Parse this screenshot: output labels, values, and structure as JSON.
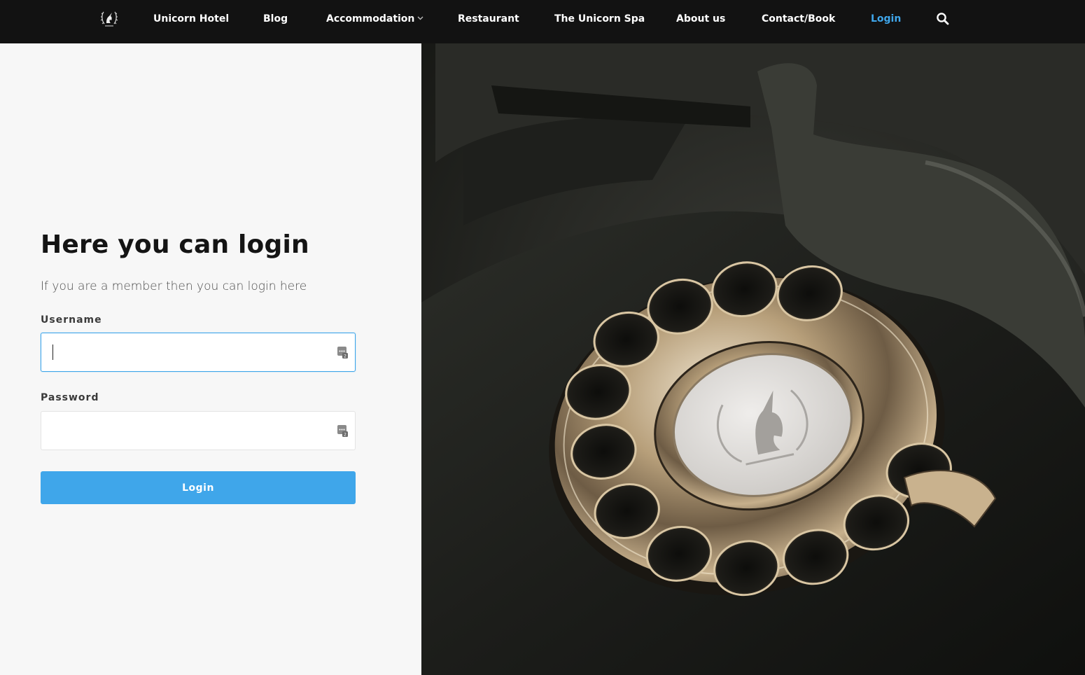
{
  "nav": {
    "logo_icon": "unicorn-laurel-logo",
    "items": [
      {
        "label": "Unicorn Hotel"
      },
      {
        "label": "Blog"
      },
      {
        "label": "Accommodation",
        "has_dropdown": true
      },
      {
        "label": "Restaurant"
      },
      {
        "label": "The Unicorn Spa"
      },
      {
        "label": "About us"
      },
      {
        "label": "Contact/Book"
      },
      {
        "label": "Login",
        "active": true
      }
    ],
    "search_icon": "search-icon"
  },
  "login": {
    "title": "Here you can login",
    "subtitle": "If you are a member then you can login here",
    "username_label": "Username",
    "username_value": "",
    "password_label": "Password",
    "password_value": "",
    "button_label": "Login"
  },
  "hero": {
    "image": "vintage-rotary-telephone-with-unicorn-emblem"
  },
  "colors": {
    "nav_bg": "#121212",
    "accent": "#3fa6ea",
    "panel_bg": "#f7f7f7"
  }
}
